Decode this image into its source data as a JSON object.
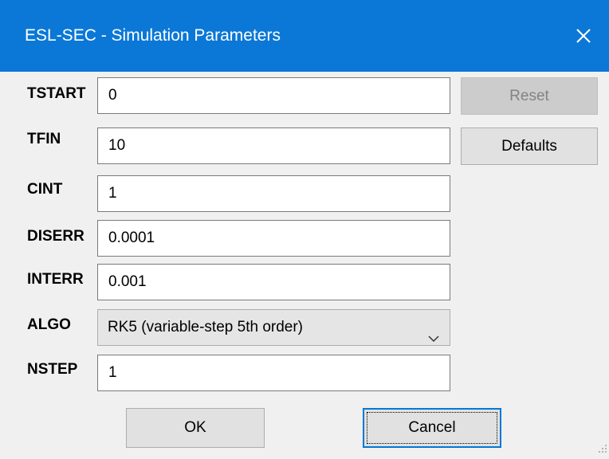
{
  "window": {
    "title": "ESL-SEC - Simulation Parameters",
    "close_icon": "close-icon",
    "accent_color": "#0b78d7"
  },
  "params": {
    "tstart": {
      "label": "TSTART",
      "value": "0"
    },
    "tfin": {
      "label": "TFIN",
      "value": "10"
    },
    "cint": {
      "label": "CINT",
      "value": "1"
    },
    "diserr": {
      "label": "DISERR",
      "value": "0.0001"
    },
    "interr": {
      "label": "INTERR",
      "value": "0.001"
    },
    "algo": {
      "label": "ALGO",
      "selected": "RK5 (variable-step 5th order)"
    },
    "nstep": {
      "label": "NSTEP",
      "value": "1"
    }
  },
  "buttons": {
    "reset": "Reset",
    "defaults": "Defaults",
    "ok": "OK",
    "cancel": "Cancel"
  }
}
